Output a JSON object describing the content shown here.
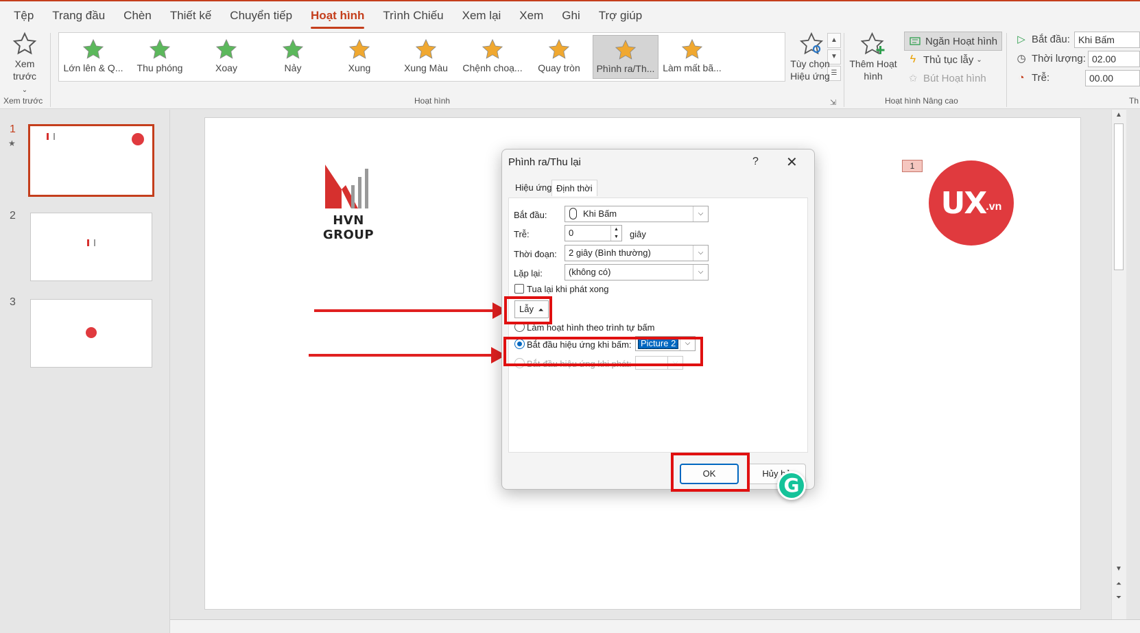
{
  "menu": {
    "tabs": [
      "Tệp",
      "Trang đầu",
      "Chèn",
      "Thiết kế",
      "Chuyển tiếp",
      "Hoạt hình",
      "Trình Chiếu",
      "Xem lại",
      "Xem",
      "Ghi",
      "Trợ giúp"
    ],
    "active_index": 5
  },
  "ribbon": {
    "preview": {
      "label": "Xem trước",
      "group_label": "Xem trước"
    },
    "gallery": {
      "items": [
        "Lớn lên & Q...",
        "Thu phóng",
        "Xoay",
        "Nảy",
        "Xung",
        "Xung Màu",
        "Chệnh choạ...",
        "Quay tròn",
        "Phình ra/Th...",
        "Làm mất bã..."
      ],
      "active_index": 8,
      "group_label": "Hoạt hình"
    },
    "effect_options": {
      "label": "Tùy chọn Hiệu ứng"
    },
    "add_animation": {
      "label": "Thêm Hoạt hình"
    },
    "animation_pane": {
      "label": "Ngăn Hoạt hình"
    },
    "trigger": {
      "label": "Thủ tục lẫy"
    },
    "animation_painter": {
      "label": "Bút Hoạt hình"
    },
    "advanced_group_label": "Hoạt hình Nâng cao",
    "timing": {
      "start_label": "Bắt đầu:",
      "start_value": "Khi Bấm",
      "duration_label": "Thời lượng:",
      "duration_value": "02.00",
      "delay_label": "Trễ:",
      "delay_value": "00.00",
      "group_label_partial": "Th"
    }
  },
  "thumbnails": {
    "numbers": [
      "1",
      "2",
      "3"
    ],
    "active_index": 0
  },
  "slide": {
    "hvn_text": "HVN GROUP",
    "ux_main": "UX",
    "ux_sub": ".vn",
    "anim_tag": "1"
  },
  "dialog": {
    "title": "Phình ra/Thu lại",
    "help": "?",
    "close": "✕",
    "tabs": [
      "Hiệu ứng",
      "Định thời"
    ],
    "active_tab": 1,
    "start_label": "Bắt đầu:",
    "start_value": "Khi Bấm",
    "delay_label": "Trễ:",
    "delay_value": "0",
    "delay_unit": "giây",
    "duration_label": "Thời đoạn:",
    "duration_value": "2 giây (Bình thường)",
    "repeat_label": "Lặp lại:",
    "repeat_value": "(không có)",
    "rewind_label": "Tua lại khi phát xong",
    "triggers_button": "Lẫy",
    "radio_sequence": "Làm hoạt hình theo trình tự bấm",
    "radio_on_click": "Bắt đầu hiệu ứng khi bấm:",
    "on_click_value": "Picture 2",
    "radio_on_play": "Bắt đầu hiệu ứng khi phát:",
    "ok": "OK",
    "cancel": "Hủy bỏ"
  },
  "grammarly": {
    "letter": "G"
  },
  "colors": {
    "accent": "#c43e1c",
    "highlight": "#e01010",
    "ux_red": "#e03a3e",
    "hvn_red": "#d6302e"
  }
}
